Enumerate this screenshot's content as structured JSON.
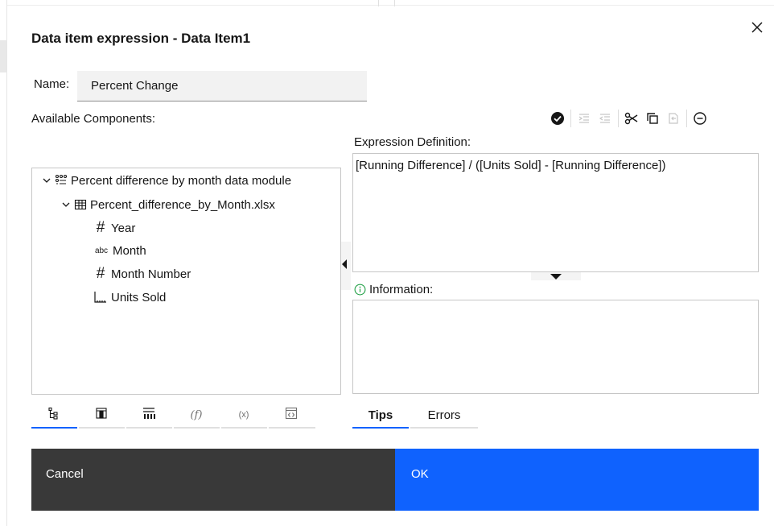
{
  "dialog": {
    "title": "Data item expression - Data Item1",
    "close_icon": "close-icon"
  },
  "name": {
    "label": "Name:",
    "value": "Percent Change"
  },
  "available": {
    "label": "Available Components:"
  },
  "toolbar": {
    "icons": [
      "validate-check-icon",
      "indent-icon",
      "outdent-icon",
      "cut-icon",
      "copy-icon",
      "paste-icon",
      "remove-icon"
    ]
  },
  "tree": {
    "root": {
      "label": "Percent difference by month data module",
      "icon": "data-module-icon"
    },
    "file": {
      "label": "Percent_difference_by_Month.xlsx",
      "icon": "table-icon"
    },
    "items": [
      {
        "label": "Year",
        "icon": "number-icon"
      },
      {
        "label": "Month",
        "icon": "text-abc-icon"
      },
      {
        "label": "Month Number",
        "icon": "number-icon"
      },
      {
        "label": "Units Sold",
        "icon": "measure-icon"
      }
    ]
  },
  "expression": {
    "label": "Expression Definition:",
    "value": "[Running Difference]  / ([Units Sold] - [Running Difference])"
  },
  "information": {
    "label": "Information:",
    "icon": "info-icon"
  },
  "bottom_tabs": {
    "icons": [
      "tree-data-icon",
      "table-columns-icon",
      "chart-icon",
      "function-icon",
      "parameter-icon",
      "macro-icon"
    ],
    "active_index": 0
  },
  "right_tabs": [
    {
      "label": "Tips",
      "active": true
    },
    {
      "label": "Errors",
      "active": false
    }
  ],
  "buttons": {
    "cancel": "Cancel",
    "ok": "OK"
  },
  "colors": {
    "primary": "#0f62fe",
    "secondary": "#393939",
    "info": "#24a148"
  }
}
